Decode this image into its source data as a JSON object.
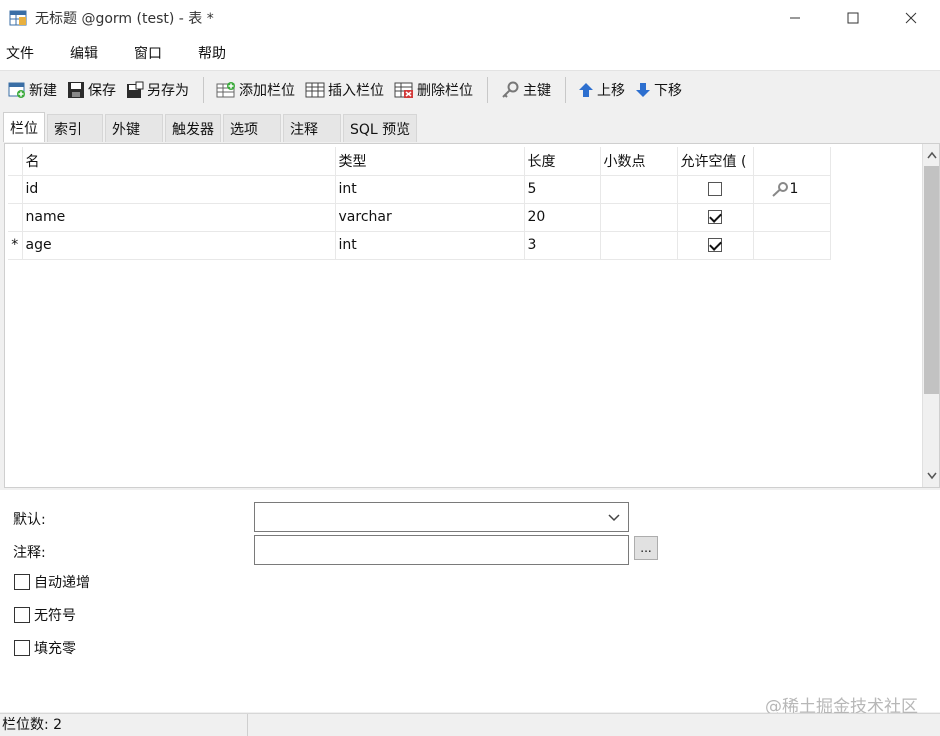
{
  "window": {
    "title": "无标题 @gorm (test) - 表 *"
  },
  "menu": {
    "items": [
      "文件",
      "编辑",
      "窗口",
      "帮助"
    ]
  },
  "toolbar": {
    "new": "新建",
    "save": "保存",
    "save_as": "另存为",
    "add_column": "添加栏位",
    "insert_column": "插入栏位",
    "delete_column": "删除栏位",
    "primary_key": "主键",
    "move_up": "上移",
    "move_down": "下移"
  },
  "tabs": [
    "栏位",
    "索引",
    "外键",
    "触发器",
    "选项",
    "注释",
    "SQL 预览"
  ],
  "grid": {
    "headers": [
      "名",
      "类型",
      "长度",
      "小数点",
      "允许空值 ("
    ],
    "rows": [
      {
        "marker": "",
        "name": "id",
        "type": "int",
        "length": "5",
        "decimal": "",
        "nullable": false,
        "key": "1"
      },
      {
        "marker": "",
        "name": "name",
        "type": "varchar",
        "length": "20",
        "decimal": "",
        "nullable": true,
        "key": ""
      },
      {
        "marker": "*",
        "name": "age",
        "type": "int",
        "length": "3",
        "decimal": "",
        "nullable": true,
        "key": ""
      }
    ]
  },
  "props": {
    "default_label": "默认:",
    "comment_label": "注释:",
    "dots": "...",
    "checkboxes": [
      {
        "label": "自动递增",
        "checked": false
      },
      {
        "label": "无符号",
        "checked": false
      },
      {
        "label": "填充零",
        "checked": false
      }
    ]
  },
  "status": {
    "text": "栏位数: 2"
  },
  "watermark": "@稀土掘金技术社区"
}
